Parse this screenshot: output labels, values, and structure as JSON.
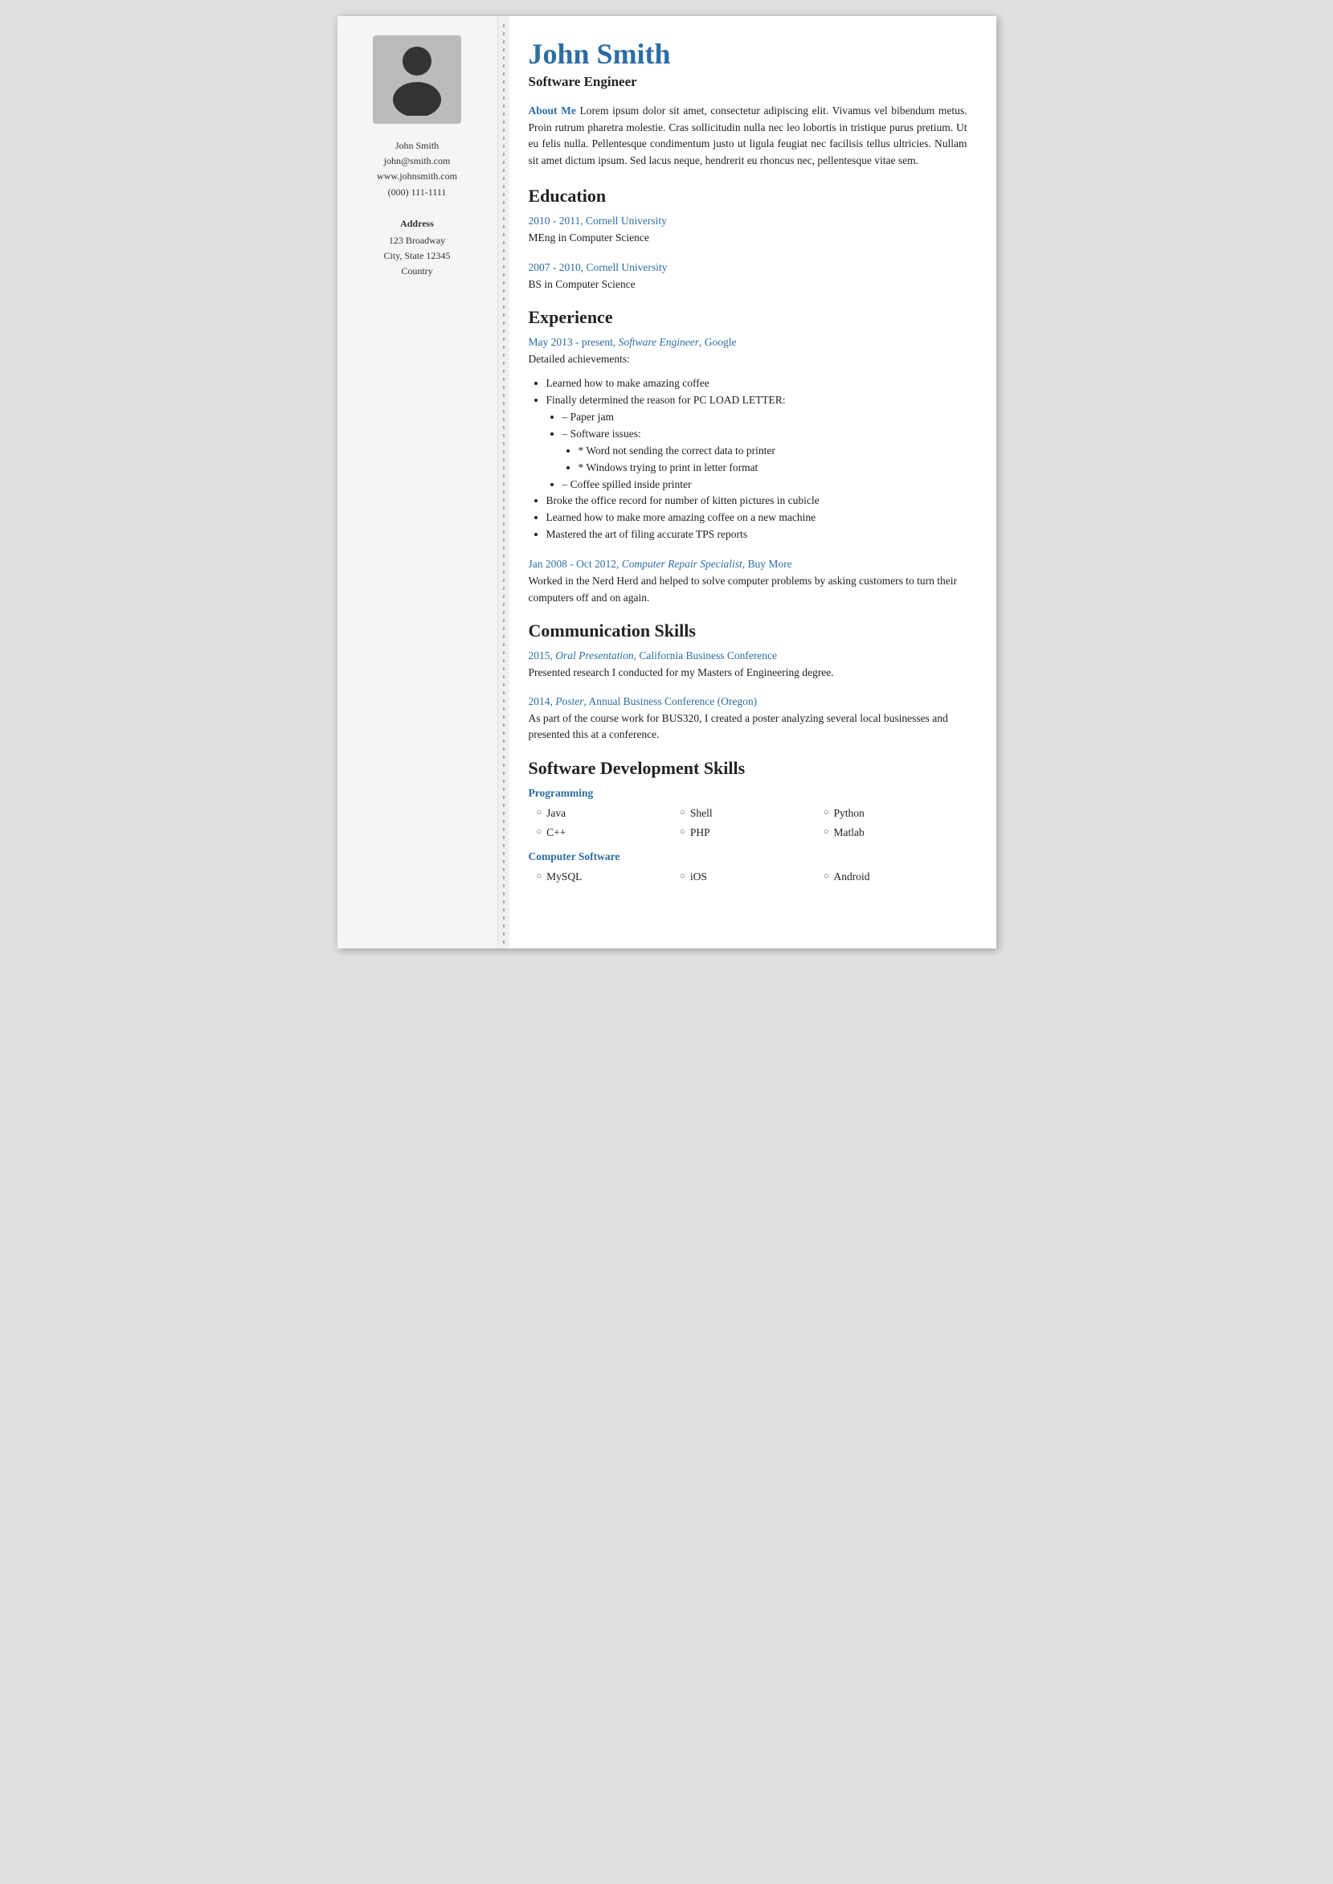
{
  "person": {
    "name": "John Smith",
    "title": "Software Engineer",
    "email": "john@smith.com",
    "website": "www.johnsmith.com",
    "phone": "(000) 111-1111",
    "address": {
      "label": "Address",
      "line1": "123 Broadway",
      "line2": "City, State 12345",
      "line3": "Country"
    }
  },
  "about_me": {
    "label": "About Me",
    "text": " Lorem ipsum dolor sit amet, consectetur adipiscing elit. Vivamus vel bibendum metus. Proin rutrum pharetra molestie. Cras sollicitudin nulla nec leo lobortis in tristique purus pretium. Ut eu felis nulla. Pellentesque condimentum justo ut ligula feugiat nec facilisis tellus ultricies. Nullam sit amet dictum ipsum. Sed lacus neque, hendrerit eu rhoncus nec, pellentesque vitae sem."
  },
  "education": {
    "title": "Education",
    "items": [
      {
        "period": "2010 - 2011, Cornell University",
        "degree": "MEng in Computer Science"
      },
      {
        "period": "2007 - 2010, Cornell University",
        "degree": "BS in Computer Science"
      }
    ]
  },
  "experience": {
    "title": "Experience",
    "items": [
      {
        "header": "May 2013 - present, Software Engineer, Google",
        "intro": "Detailed achievements:",
        "bullets": [
          "Learned how to make amazing coffee",
          "Finally determined the reason for PC LOAD LETTER:",
          "Broke the office record for number of kitten pictures in cubicle",
          "Learned how to make more amazing coffee on a new machine",
          "Mastered the art of filing accurate TPS reports"
        ],
        "sub_bullets": [
          "Paper jam",
          "Software issues:"
        ],
        "sub_sub_bullets": [
          "Word not sending the correct data to printer",
          "Windows trying to print in letter format"
        ],
        "last_sub": "Coffee spilled inside printer"
      },
      {
        "header": "Jan 2008 - Oct 2012, Computer Repair Specialist, Buy More",
        "body": "Worked in the Nerd Herd and helped to solve computer problems by asking customers to turn their computers off and on again."
      }
    ]
  },
  "communication": {
    "title": "Communication Skills",
    "items": [
      {
        "header": "2015, Oral Presentation, California Business Conference",
        "body": "Presented research I conducted for my Masters of Engineering degree."
      },
      {
        "header": "2014, Poster, Annual Business Conference (Oregon)",
        "body": "As part of the course work for BUS320, I created a poster analyzing several local businesses and presented this at a conference."
      }
    ]
  },
  "skills": {
    "title": "Software Development Skills",
    "categories": [
      {
        "name": "Programming",
        "items": [
          "Java",
          "C++",
          "Shell",
          "PHP",
          "Python",
          "Matlab"
        ]
      },
      {
        "name": "Computer Software",
        "items": [
          "MySQL",
          "iOS",
          "Android"
        ]
      }
    ]
  }
}
